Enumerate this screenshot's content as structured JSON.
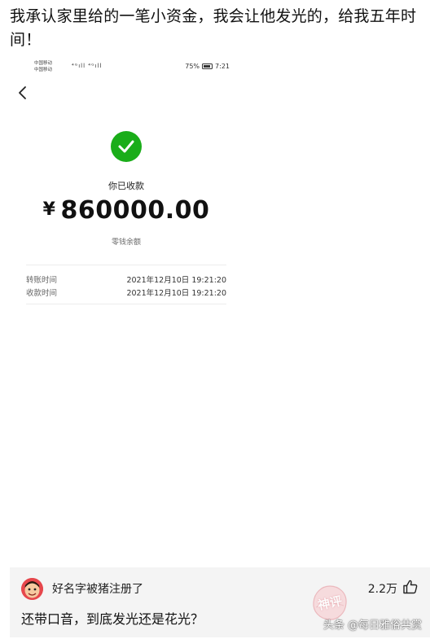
{
  "post": {
    "title": "我承认家里给的一笔小资金，我会让他发光的，给我五年时间！"
  },
  "phone": {
    "status": {
      "carrier_line1": "中国移动",
      "carrier_line2": "中国移动",
      "signal_text": "⁴ᴳıll ⁴ᴳıll",
      "right_text": "75%",
      "time": "7:21"
    },
    "payment": {
      "received_label": "你已收款",
      "currency": "¥",
      "amount": "860000.00",
      "balance_link": "零钱余额"
    },
    "details": [
      {
        "key": "转账时间",
        "value": "2021年12月10日 19:21:20"
      },
      {
        "key": "收款时间",
        "value": "2021年12月10日 19:21:20"
      }
    ],
    "colors": {
      "success_green": "#1aad19"
    }
  },
  "comment": {
    "username": "好名字被猪注册了",
    "likes": "2.2万",
    "text": "还带口音，到底发光还是花光？"
  },
  "watermark": {
    "stamp_text": "神评",
    "source": "头条 @每日雅俗共赏"
  },
  "icons": {
    "back": "back-arrow-icon",
    "check": "checkmark-icon",
    "like": "thumbs-up-icon",
    "battery": "battery-icon"
  }
}
